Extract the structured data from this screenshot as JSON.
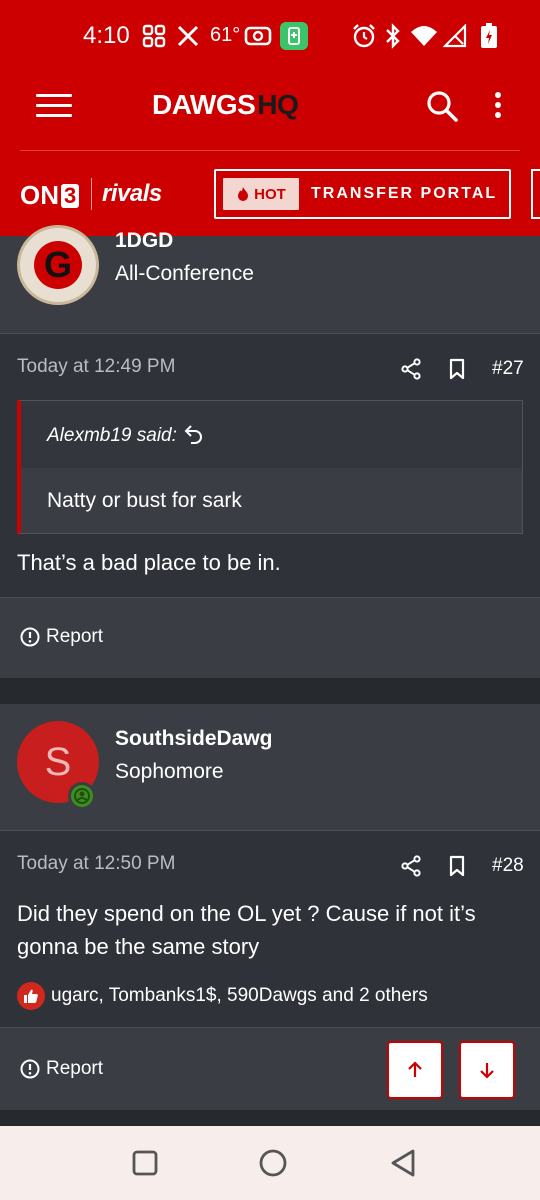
{
  "status_bar": {
    "time": "4:10",
    "temperature": "61°",
    "icons": [
      "grid-apps-icon",
      "x-logo-icon",
      "radio-icon",
      "battery-saver-icon",
      "alarm-icon",
      "bluetooth-icon",
      "wifi-icon",
      "signal-icon",
      "battery-charging-icon"
    ]
  },
  "header": {
    "logo_main": "DAWGS",
    "logo_hq": "HQ",
    "icons": [
      "menu-icon",
      "search-icon",
      "more-vertical-icon"
    ]
  },
  "promo": {
    "on3_text": "ON",
    "on3_num": "3",
    "rivals": "rivals",
    "hot_badge": "HOT",
    "transfer_label": "TRANSFER PORTAL"
  },
  "posts": [
    {
      "username": "1DGD",
      "user_title": "All-Conference",
      "avatar_letter": "G",
      "date": "Today at 12:49 PM",
      "number": "#27",
      "quote_author": "Alexmb19 said:",
      "quote_text": "Natty or bust for sark",
      "body": "That’s a bad place to be in.",
      "report_label": "Report"
    },
    {
      "username": "SouthsideDawg",
      "user_title": "Sophomore",
      "avatar_letter": "S",
      "date": "Today at 12:50 PM",
      "number": "#28",
      "body": "Did they spend on the OL yet ? Cause if not it’s gonna be the same story",
      "likes": "ugarc, Tombanks1$, 590Dawgs and 2 others",
      "report_label": "Report"
    }
  ],
  "colors": {
    "brand_red": "#cc0000",
    "panel": "#3a3d44",
    "background": "#2f3238"
  }
}
